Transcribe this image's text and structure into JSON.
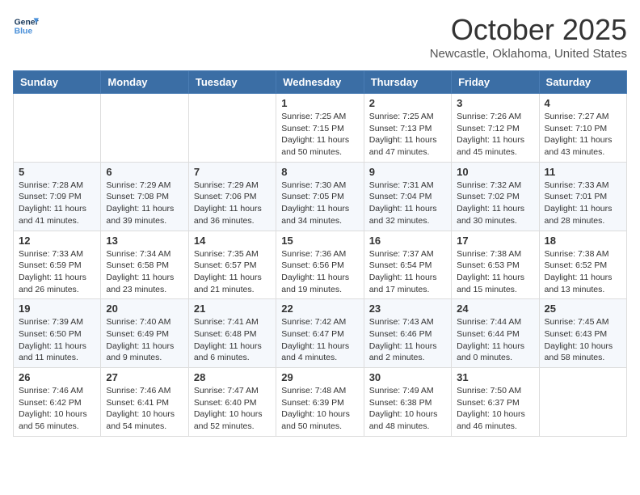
{
  "header": {
    "logo_line1": "General",
    "logo_line2": "Blue",
    "month": "October 2025",
    "location": "Newcastle, Oklahoma, United States"
  },
  "weekdays": [
    "Sunday",
    "Monday",
    "Tuesday",
    "Wednesday",
    "Thursday",
    "Friday",
    "Saturday"
  ],
  "weeks": [
    [
      {
        "day": "",
        "info": ""
      },
      {
        "day": "",
        "info": ""
      },
      {
        "day": "",
        "info": ""
      },
      {
        "day": "1",
        "info": "Sunrise: 7:25 AM\nSunset: 7:15 PM\nDaylight: 11 hours\nand 50 minutes."
      },
      {
        "day": "2",
        "info": "Sunrise: 7:25 AM\nSunset: 7:13 PM\nDaylight: 11 hours\nand 47 minutes."
      },
      {
        "day": "3",
        "info": "Sunrise: 7:26 AM\nSunset: 7:12 PM\nDaylight: 11 hours\nand 45 minutes."
      },
      {
        "day": "4",
        "info": "Sunrise: 7:27 AM\nSunset: 7:10 PM\nDaylight: 11 hours\nand 43 minutes."
      }
    ],
    [
      {
        "day": "5",
        "info": "Sunrise: 7:28 AM\nSunset: 7:09 PM\nDaylight: 11 hours\nand 41 minutes."
      },
      {
        "day": "6",
        "info": "Sunrise: 7:29 AM\nSunset: 7:08 PM\nDaylight: 11 hours\nand 39 minutes."
      },
      {
        "day": "7",
        "info": "Sunrise: 7:29 AM\nSunset: 7:06 PM\nDaylight: 11 hours\nand 36 minutes."
      },
      {
        "day": "8",
        "info": "Sunrise: 7:30 AM\nSunset: 7:05 PM\nDaylight: 11 hours\nand 34 minutes."
      },
      {
        "day": "9",
        "info": "Sunrise: 7:31 AM\nSunset: 7:04 PM\nDaylight: 11 hours\nand 32 minutes."
      },
      {
        "day": "10",
        "info": "Sunrise: 7:32 AM\nSunset: 7:02 PM\nDaylight: 11 hours\nand 30 minutes."
      },
      {
        "day": "11",
        "info": "Sunrise: 7:33 AM\nSunset: 7:01 PM\nDaylight: 11 hours\nand 28 minutes."
      }
    ],
    [
      {
        "day": "12",
        "info": "Sunrise: 7:33 AM\nSunset: 6:59 PM\nDaylight: 11 hours\nand 26 minutes."
      },
      {
        "day": "13",
        "info": "Sunrise: 7:34 AM\nSunset: 6:58 PM\nDaylight: 11 hours\nand 23 minutes."
      },
      {
        "day": "14",
        "info": "Sunrise: 7:35 AM\nSunset: 6:57 PM\nDaylight: 11 hours\nand 21 minutes."
      },
      {
        "day": "15",
        "info": "Sunrise: 7:36 AM\nSunset: 6:56 PM\nDaylight: 11 hours\nand 19 minutes."
      },
      {
        "day": "16",
        "info": "Sunrise: 7:37 AM\nSunset: 6:54 PM\nDaylight: 11 hours\nand 17 minutes."
      },
      {
        "day": "17",
        "info": "Sunrise: 7:38 AM\nSunset: 6:53 PM\nDaylight: 11 hours\nand 15 minutes."
      },
      {
        "day": "18",
        "info": "Sunrise: 7:38 AM\nSunset: 6:52 PM\nDaylight: 11 hours\nand 13 minutes."
      }
    ],
    [
      {
        "day": "19",
        "info": "Sunrise: 7:39 AM\nSunset: 6:50 PM\nDaylight: 11 hours\nand 11 minutes."
      },
      {
        "day": "20",
        "info": "Sunrise: 7:40 AM\nSunset: 6:49 PM\nDaylight: 11 hours\nand 9 minutes."
      },
      {
        "day": "21",
        "info": "Sunrise: 7:41 AM\nSunset: 6:48 PM\nDaylight: 11 hours\nand 6 minutes."
      },
      {
        "day": "22",
        "info": "Sunrise: 7:42 AM\nSunset: 6:47 PM\nDaylight: 11 hours\nand 4 minutes."
      },
      {
        "day": "23",
        "info": "Sunrise: 7:43 AM\nSunset: 6:46 PM\nDaylight: 11 hours\nand 2 minutes."
      },
      {
        "day": "24",
        "info": "Sunrise: 7:44 AM\nSunset: 6:44 PM\nDaylight: 11 hours\nand 0 minutes."
      },
      {
        "day": "25",
        "info": "Sunrise: 7:45 AM\nSunset: 6:43 PM\nDaylight: 10 hours\nand 58 minutes."
      }
    ],
    [
      {
        "day": "26",
        "info": "Sunrise: 7:46 AM\nSunset: 6:42 PM\nDaylight: 10 hours\nand 56 minutes."
      },
      {
        "day": "27",
        "info": "Sunrise: 7:46 AM\nSunset: 6:41 PM\nDaylight: 10 hours\nand 54 minutes."
      },
      {
        "day": "28",
        "info": "Sunrise: 7:47 AM\nSunset: 6:40 PM\nDaylight: 10 hours\nand 52 minutes."
      },
      {
        "day": "29",
        "info": "Sunrise: 7:48 AM\nSunset: 6:39 PM\nDaylight: 10 hours\nand 50 minutes."
      },
      {
        "day": "30",
        "info": "Sunrise: 7:49 AM\nSunset: 6:38 PM\nDaylight: 10 hours\nand 48 minutes."
      },
      {
        "day": "31",
        "info": "Sunrise: 7:50 AM\nSunset: 6:37 PM\nDaylight: 10 hours\nand 46 minutes."
      },
      {
        "day": "",
        "info": ""
      }
    ]
  ]
}
